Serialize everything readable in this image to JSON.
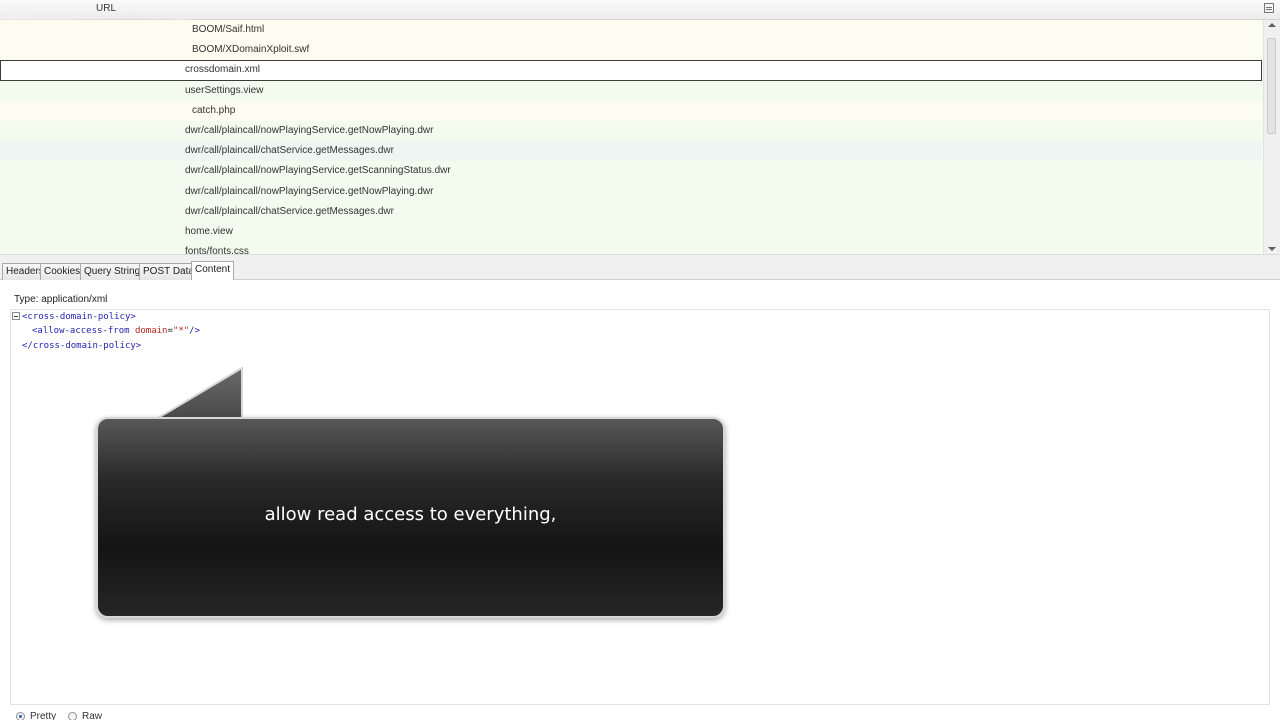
{
  "request_list": {
    "column_header": "URL",
    "rows": [
      {
        "url": "BOOM/Saif.html",
        "indent": true,
        "bg": "y"
      },
      {
        "url": "BOOM/XDomainXploit.swf",
        "indent": true,
        "bg": "y"
      },
      {
        "url": "crossdomain.xml",
        "indent": false,
        "bg": "sel"
      },
      {
        "url": "userSettings.view",
        "indent": false,
        "bg": "g"
      },
      {
        "url": "catch.php",
        "indent": true,
        "bg": "y"
      },
      {
        "url": "dwr/call/plaincall/nowPlayingService.getNowPlaying.dwr",
        "indent": false,
        "bg": "g"
      },
      {
        "url": "dwr/call/plaincall/chatService.getMessages.dwr",
        "indent": false,
        "bg": "hov"
      },
      {
        "url": "dwr/call/plaincall/nowPlayingService.getScanningStatus.dwr",
        "indent": false,
        "bg": "g"
      },
      {
        "url": "dwr/call/plaincall/nowPlayingService.getNowPlaying.dwr",
        "indent": false,
        "bg": "g"
      },
      {
        "url": "dwr/call/plaincall/chatService.getMessages.dwr",
        "indent": false,
        "bg": "g"
      },
      {
        "url": "home.view",
        "indent": false,
        "bg": "g"
      },
      {
        "url": "fonts/fonts.css",
        "indent": false,
        "bg": "g"
      }
    ]
  },
  "tabs": [
    {
      "label": "Headers",
      "active": false
    },
    {
      "label": "Cookies",
      "active": false
    },
    {
      "label": "Query String",
      "active": false
    },
    {
      "label": "POST Data",
      "active": false
    },
    {
      "label": "Content",
      "active": true
    }
  ],
  "content": {
    "type_label": "Type: application/xml",
    "xml": {
      "open_tag": "<cross-domain-policy>",
      "child_open": "<allow-access-from",
      "attr_name": "domain",
      "attr_eq": "=",
      "attr_value": "\"*\"",
      "child_close": "/>",
      "close_tag": "</cross-domain-policy>"
    },
    "view_options": [
      {
        "label": "Pretty",
        "selected": true
      },
      {
        "label": "Raw",
        "selected": false
      }
    ]
  },
  "callout": {
    "text": "allow read access to everything,"
  }
}
